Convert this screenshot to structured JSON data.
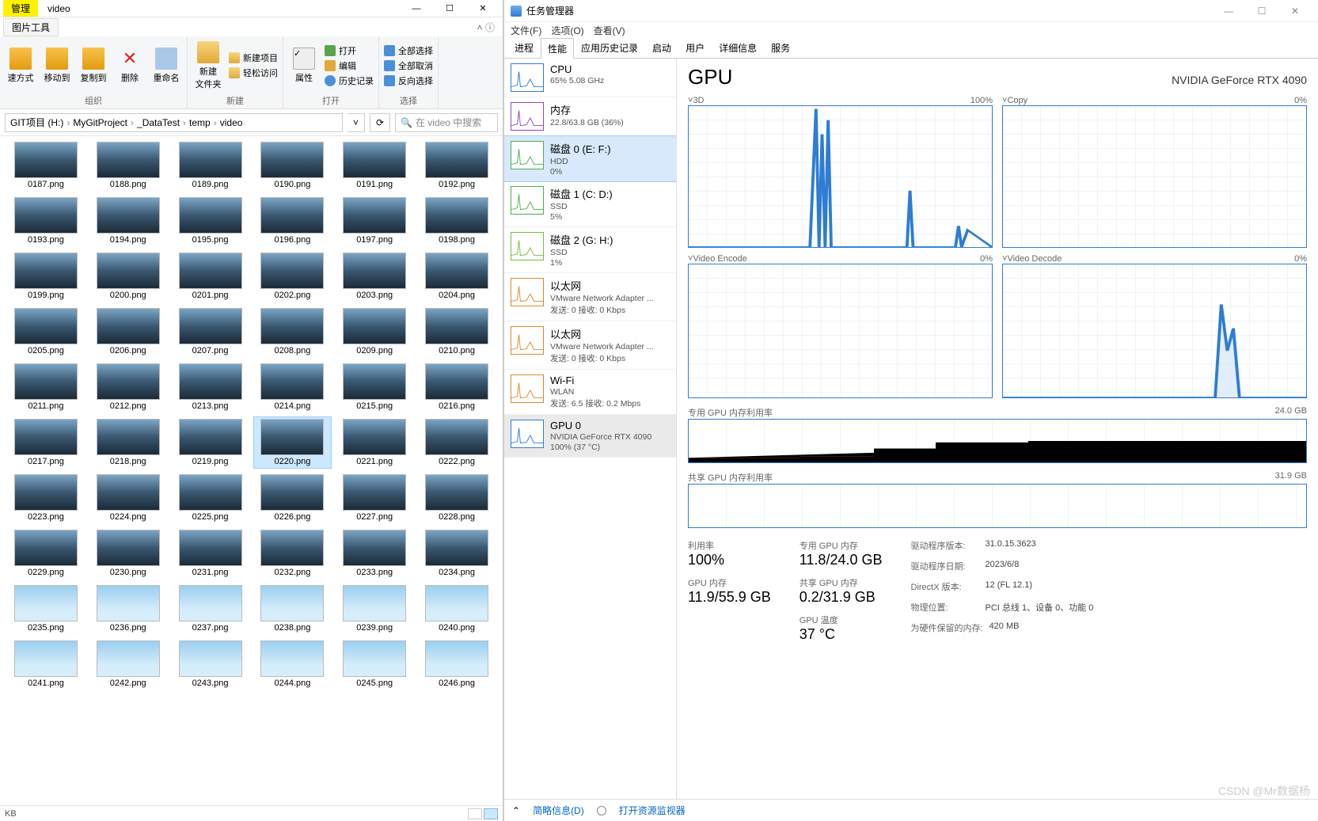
{
  "explorer": {
    "title_tabs": {
      "manage": "管理",
      "video": "video"
    },
    "ribbon_tab": "图片工具",
    "window_controls": {
      "min": "—",
      "max": "☐",
      "close": "✕"
    },
    "ribbon": {
      "clipboard": {
        "pin": "速方式",
        "move": "移动到",
        "copy": "复制到",
        "delete": "删除",
        "rename": "重命名",
        "label": "组织"
      },
      "new": {
        "newfolder": "新建\n文件夹",
        "newitem": "新建项目",
        "easyaccess": "轻松访问",
        "label": "新建"
      },
      "open": {
        "props": "属性",
        "open": "打开",
        "edit": "编辑",
        "history": "历史记录",
        "label": "打开"
      },
      "select": {
        "all": "全部选择",
        "none": "全部取消",
        "invert": "反向选择",
        "label": "选择"
      }
    },
    "breadcrumb": [
      "GIT项目 (H:)",
      "MyGitProject",
      "_DataTest",
      "temp",
      "video"
    ],
    "search_placeholder": "在 video 中搜索",
    "files_start": 187,
    "files_end": 246,
    "selected": "0220.png",
    "sky_from": 235,
    "status_left": "KB"
  },
  "taskmgr": {
    "title": "任务管理器",
    "menu": [
      "文件(F)",
      "选项(O)",
      "查看(V)"
    ],
    "tabs": [
      "进程",
      "性能",
      "应用历史记录",
      "启动",
      "用户",
      "详细信息",
      "服务"
    ],
    "active_tab": "性能",
    "side": [
      {
        "id": "cpu",
        "title": "CPU",
        "l2": "65%  5.08 GHz",
        "color": "#2E7CD6"
      },
      {
        "id": "mem",
        "title": "内存",
        "l2": "22.8/63.8 GB (36%)",
        "color": "#9146c6"
      },
      {
        "id": "disk0",
        "title": "磁盘 0 (E: F:)",
        "l2": "HDD",
        "l3": "0%",
        "color": "#4caf50",
        "sel": true
      },
      {
        "id": "disk1",
        "title": "磁盘 1 (C: D:)",
        "l2": "SSD",
        "l3": "5%",
        "color": "#4caf50"
      },
      {
        "id": "disk2",
        "title": "磁盘 2 (G: H:)",
        "l2": "SSD",
        "l3": "1%",
        "color": "#6fbf3f"
      },
      {
        "id": "eth0",
        "title": "以太网",
        "l2": "VMware Network Adapter ...",
        "l3": "发送: 0 接收: 0 Kbps",
        "color": "#d68b2e"
      },
      {
        "id": "eth1",
        "title": "以太网",
        "l2": "VMware Network Adapter ...",
        "l3": "发送: 0 接收: 0 Kbps",
        "color": "#d68b2e"
      },
      {
        "id": "wifi",
        "title": "Wi-Fi",
        "l2": "WLAN",
        "l3": "发送: 6.5 接收: 0.2 Mbps",
        "color": "#d68b2e"
      },
      {
        "id": "gpu",
        "title": "GPU 0",
        "l2": "NVIDIA GeForce RTX 4090",
        "l3": "100% (37 °C)",
        "color": "#2E7CD6",
        "act": true
      }
    ],
    "main": {
      "title": "GPU",
      "subtitle": "NVIDIA GeForce RTX 4090",
      "graphs": {
        "g3d": {
          "label": "3D",
          "right": "100%"
        },
        "copy": {
          "label": "Copy",
          "right": "0%"
        },
        "venc": {
          "label": "Video Encode",
          "right": "0%"
        },
        "vdec": {
          "label": "Video Decode",
          "right": "0%"
        }
      },
      "mem_dedicated": {
        "label": "专用 GPU 内存利用率",
        "right": "24.0 GB"
      },
      "mem_shared": {
        "label": "共享 GPU 内存利用率",
        "right": "31.9 GB"
      },
      "stats": {
        "util": {
          "label": "利用率",
          "value": "100%"
        },
        "dedmem": {
          "label": "专用 GPU 内存",
          "value": "11.8/24.0 GB"
        },
        "gpumem": {
          "label": "GPU 内存",
          "value": "11.9/55.9 GB"
        },
        "shamem": {
          "label": "共享 GPU 内存",
          "value": "0.2/31.9 GB"
        },
        "temp": {
          "label": "GPU 温度",
          "value": "37 °C"
        },
        "drvver": {
          "k": "驱动程序版本:",
          "v": "31.0.15.3623"
        },
        "drvdate": {
          "k": "驱动程序日期:",
          "v": "2023/6/8"
        },
        "dx": {
          "k": "DirectX 版本:",
          "v": "12 (FL 12.1)"
        },
        "loc": {
          "k": "物理位置:",
          "v": "PCI 总线 1、设备 0、功能 0"
        },
        "hwres": {
          "k": "为硬件保留的内存:",
          "v": "420 MB"
        }
      }
    },
    "footer": {
      "brief": "简略信息(D)",
      "resmon": "打开资源监视器"
    },
    "watermark": "CSDN @Mr数据杨"
  }
}
